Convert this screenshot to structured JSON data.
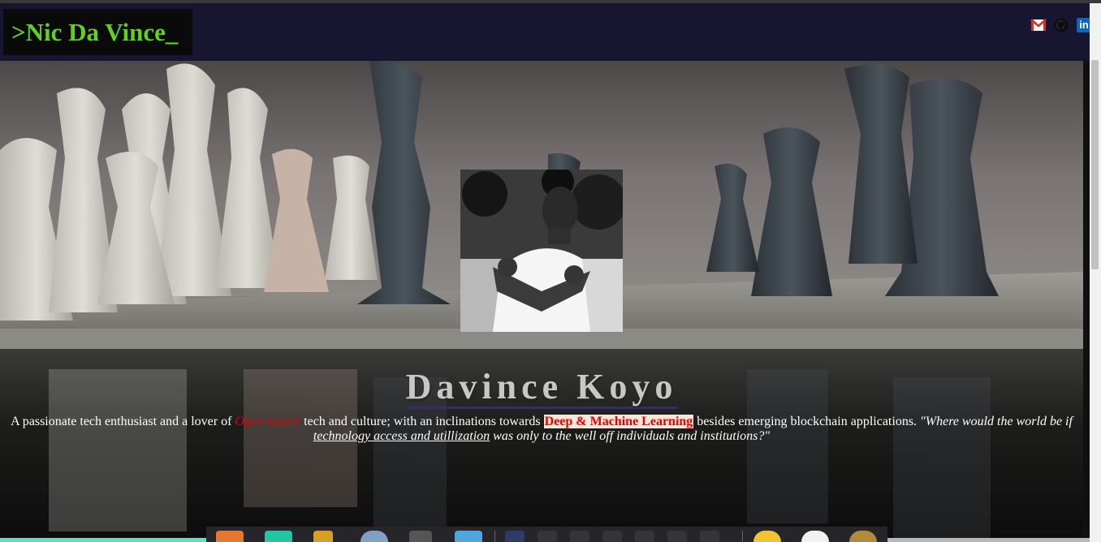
{
  "header": {
    "brand": ">Nic Da Vince_",
    "social": [
      {
        "name": "gmail",
        "icon": "gmail-icon"
      },
      {
        "name": "github",
        "icon": "github-icon"
      },
      {
        "name": "linkedin",
        "icon": "linkedin-icon",
        "text": "in"
      }
    ]
  },
  "hero": {
    "name": "Davince Koyo",
    "bio": {
      "p1": "A passionate tech enthusiast and a lover of ",
      "open_source": "Open source",
      "p2": " tech and culture; with an inclinations towards ",
      "highlight": "Deep & Machine Learning",
      "p3": " besides emerging blockchain applications. ",
      "quote_start": "\"Where would the world be if ",
      "quote_underline": "technology access and utillization",
      "quote_end": " was only to the well off individuals and institutions?\""
    }
  },
  "colors": {
    "navbar": "#171631",
    "brand_text": "#5fd21e",
    "accent_red": "#e60000",
    "highlight_bg": "#fbe6d9"
  },
  "taskbar": {
    "icons": [
      "firefox-icon",
      "terminal-icon",
      "settings-icon",
      "chrome-icon",
      "sublime-icon",
      "files-icon",
      "app-icon",
      "app-icon",
      "app-icon",
      "app-icon",
      "app-icon",
      "app-icon",
      "app-icon",
      "app-icon",
      "clock-icon",
      "power-icon",
      "user-icon"
    ]
  }
}
